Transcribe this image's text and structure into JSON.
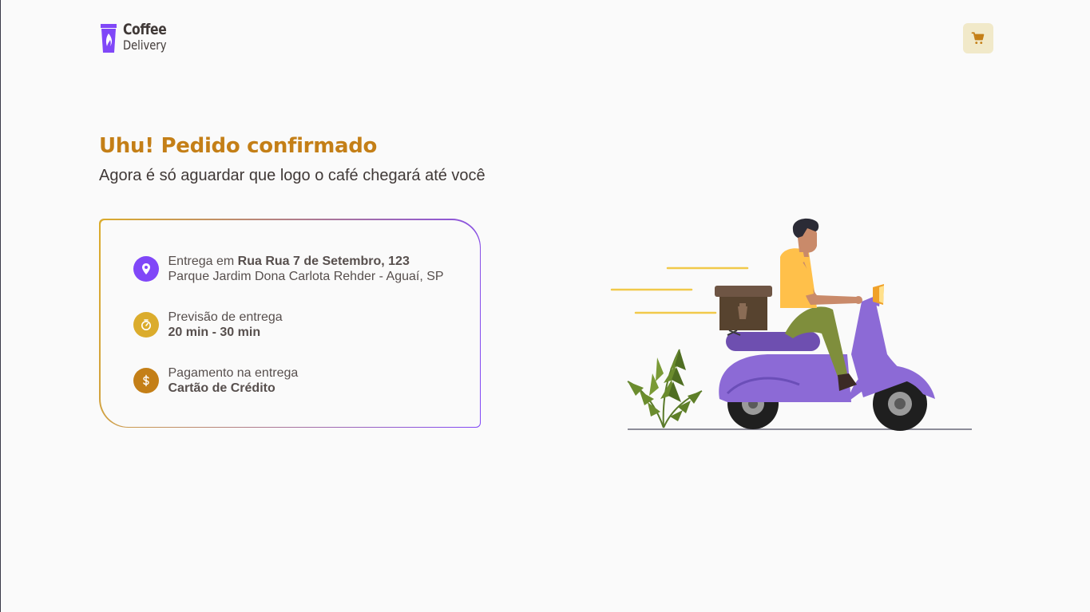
{
  "header": {
    "logo": {
      "line1": "Coffee",
      "line2": "Delivery"
    },
    "cart_icon": "shopping-cart-icon"
  },
  "page": {
    "title": "Uhu! Pedido confirmado",
    "subtitle": "Agora é só aguardar que logo o café chegará até você"
  },
  "order_info": {
    "delivery": {
      "icon": "map-pin-icon",
      "color": "#8047f8",
      "prefix": "Entrega em ",
      "street": "Rua Rua 7 de Setembro, 123",
      "area": "Parque Jardim Dona Carlota Rehder - Aguaí, SP"
    },
    "estimate": {
      "icon": "timer-icon",
      "color": "#dbac2c",
      "label": "Previsão de entrega",
      "value": "20 min - 30 min"
    },
    "payment": {
      "icon": "currency-dollar-icon",
      "color": "#c47f17",
      "label": "Pagamento na entrega",
      "value": "Cartão de Crédito"
    }
  },
  "colors": {
    "brand_purple": "#8047f8",
    "brand_yellow": "#dbac2c",
    "brand_yellow_dark": "#c47f17",
    "text": "#403937",
    "background": "#fafafa"
  }
}
